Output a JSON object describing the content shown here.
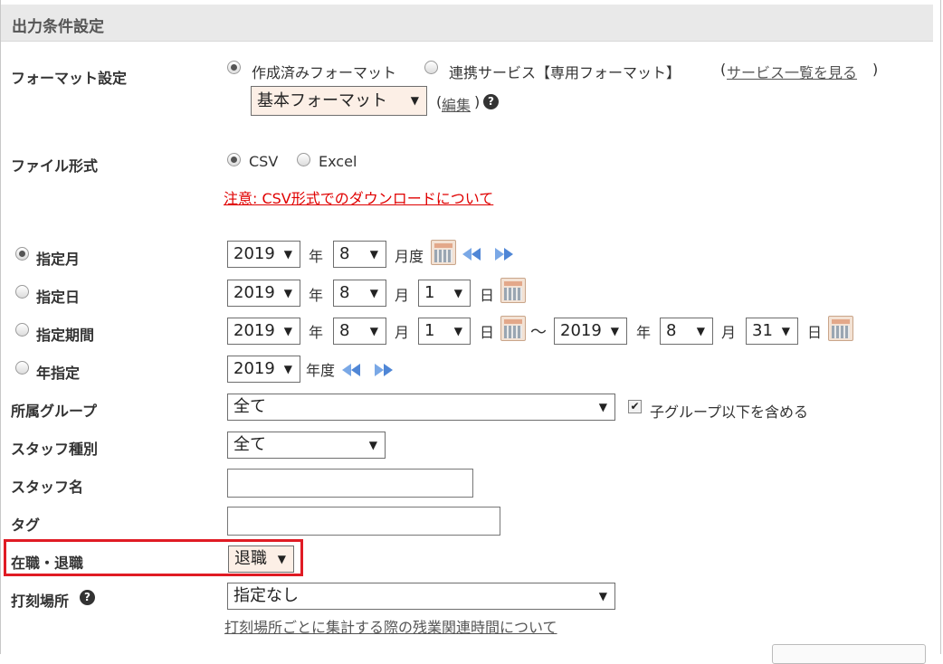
{
  "section_title": "出力条件設定",
  "format": {
    "label": "フォーマット設定",
    "option_created": "作成済みフォーマット",
    "option_linked": "連携サービス【専用フォーマット】",
    "paren_open": "(",
    "service_list_link": "サービス一覧を見る",
    "paren_close": ")",
    "select_value": "基本フォーマット",
    "edit_paren_open": "(",
    "edit_link": "編集",
    "edit_paren_close": ")",
    "selected": "作成済みフォーマット"
  },
  "file_type": {
    "label": "ファイル形式",
    "option_csv": "CSV",
    "option_excel": "Excel",
    "selected": "CSV",
    "csv_notice_link": "注意: CSV形式でのダウンロードについて"
  },
  "period": {
    "selected": "指定月",
    "month": {
      "label": "指定月",
      "year": "2019",
      "year_unit": "年",
      "month": "8",
      "month_unit": "月度"
    },
    "day": {
      "label": "指定日",
      "year": "2019",
      "year_unit": "年",
      "month": "8",
      "month_unit": "月",
      "day": "1",
      "day_unit": "日"
    },
    "range": {
      "label": "指定期間",
      "from_year": "2019",
      "from_month": "8",
      "from_day": "1",
      "tilde": "〜",
      "to_year": "2019",
      "to_month": "8",
      "to_day": "31",
      "year_unit": "年",
      "month_unit": "月",
      "day_unit": "日"
    },
    "fiscal": {
      "label": "年指定",
      "year": "2019",
      "year_unit": "年度"
    }
  },
  "group": {
    "label": "所属グループ",
    "value": "全て",
    "include_sub_label": "子グループ以下を含める",
    "include_sub_checked": true
  },
  "staff_type": {
    "label": "スタッフ種別",
    "value": "全て"
  },
  "staff_name": {
    "label": "スタッフ名",
    "value": ""
  },
  "tag": {
    "label": "タグ",
    "value": ""
  },
  "employment": {
    "label": "在職・退職",
    "value": "退職",
    "highlight_color": "#e01b24"
  },
  "punch_place": {
    "label": "打刻場所",
    "value": "指定なし",
    "info_link": "打刻場所ごとに集計する際の残業関連時間について"
  },
  "colors": {
    "link_gray": "#555555",
    "link_red": "#e00000",
    "header_bg": "#e9e9e9"
  },
  "icons": [
    "calendar-icon",
    "prev-next-arrows-icon",
    "help-icon",
    "checkbox-checked-icon"
  ]
}
